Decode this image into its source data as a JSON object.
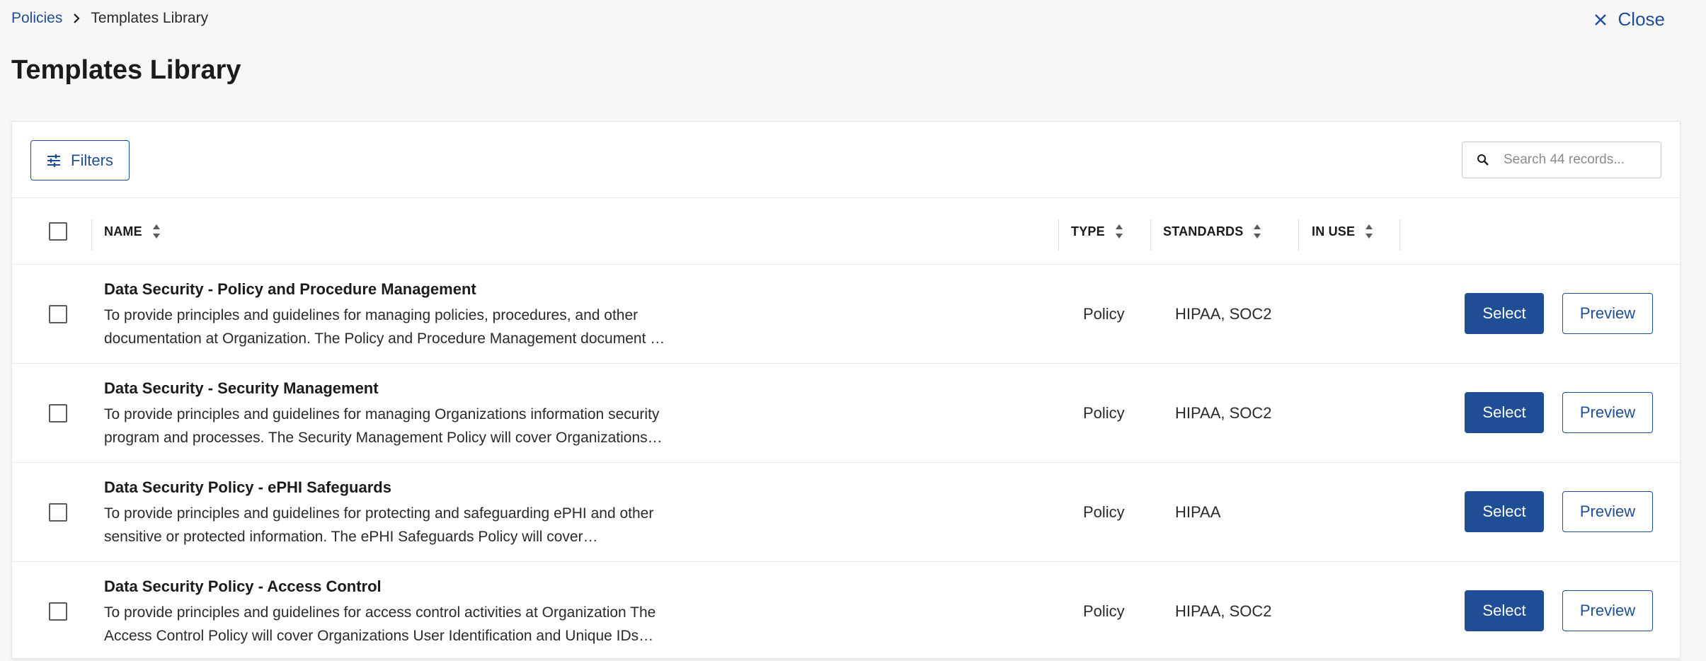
{
  "breadcrumb": {
    "parent": "Policies",
    "current": "Templates Library"
  },
  "close_label": "Close",
  "page_title": "Templates Library",
  "toolbar": {
    "filters_label": "Filters",
    "search_placeholder": "Search 44 records...",
    "search_value": ""
  },
  "table": {
    "columns": {
      "name": "NAME",
      "type": "TYPE",
      "standards": "STANDARDS",
      "in_use": "IN USE"
    },
    "rows": [
      {
        "name": "Data Security - Policy and Procedure Management",
        "desc_line1": "To provide principles and guidelines for managing policies, procedures, and other",
        "desc_line2": "documentation at Organization. The Policy and Procedure Management document wi…",
        "type": "Policy",
        "standards": "HIPAA, SOC2",
        "in_use": "",
        "select_label": "Select",
        "preview_label": "Preview"
      },
      {
        "name": "Data Security - Security Management",
        "desc_line1": "To provide principles and guidelines for managing Organizations information security",
        "desc_line2": "program and processes. The Security Management Policy will cover Organizations…",
        "type": "Policy",
        "standards": "HIPAA, SOC2",
        "in_use": "",
        "select_label": "Select",
        "preview_label": "Preview"
      },
      {
        "name": "Data Security Policy - ePHI Safeguards",
        "desc_line1": "To provide principles and guidelines for protecting and safeguarding ePHI and other",
        "desc_line2": "sensitive or protected information. The ePHI Safeguards Policy will cover…",
        "type": "Policy",
        "standards": "HIPAA",
        "in_use": "",
        "select_label": "Select",
        "preview_label": "Preview"
      },
      {
        "name": "Data Security Policy - Access Control",
        "desc_line1": "To provide principles and guidelines for access control activities at Organization The",
        "desc_line2": "Access Control Policy will cover Organizations User Identification and Unique IDs…",
        "type": "Policy",
        "standards": "HIPAA, SOC2",
        "in_use": "",
        "select_label": "Select",
        "preview_label": "Preview"
      }
    ]
  },
  "colors": {
    "accent": "#1f4e96",
    "background": "#f7f7f7",
    "card": "#ffffff",
    "border": "#e9e9e9"
  },
  "icons": {
    "breadcrumb_separator": "chevron-right-icon",
    "close": "close-icon",
    "filters": "sliders-icon",
    "search": "search-icon",
    "sort": "sort-icon"
  }
}
